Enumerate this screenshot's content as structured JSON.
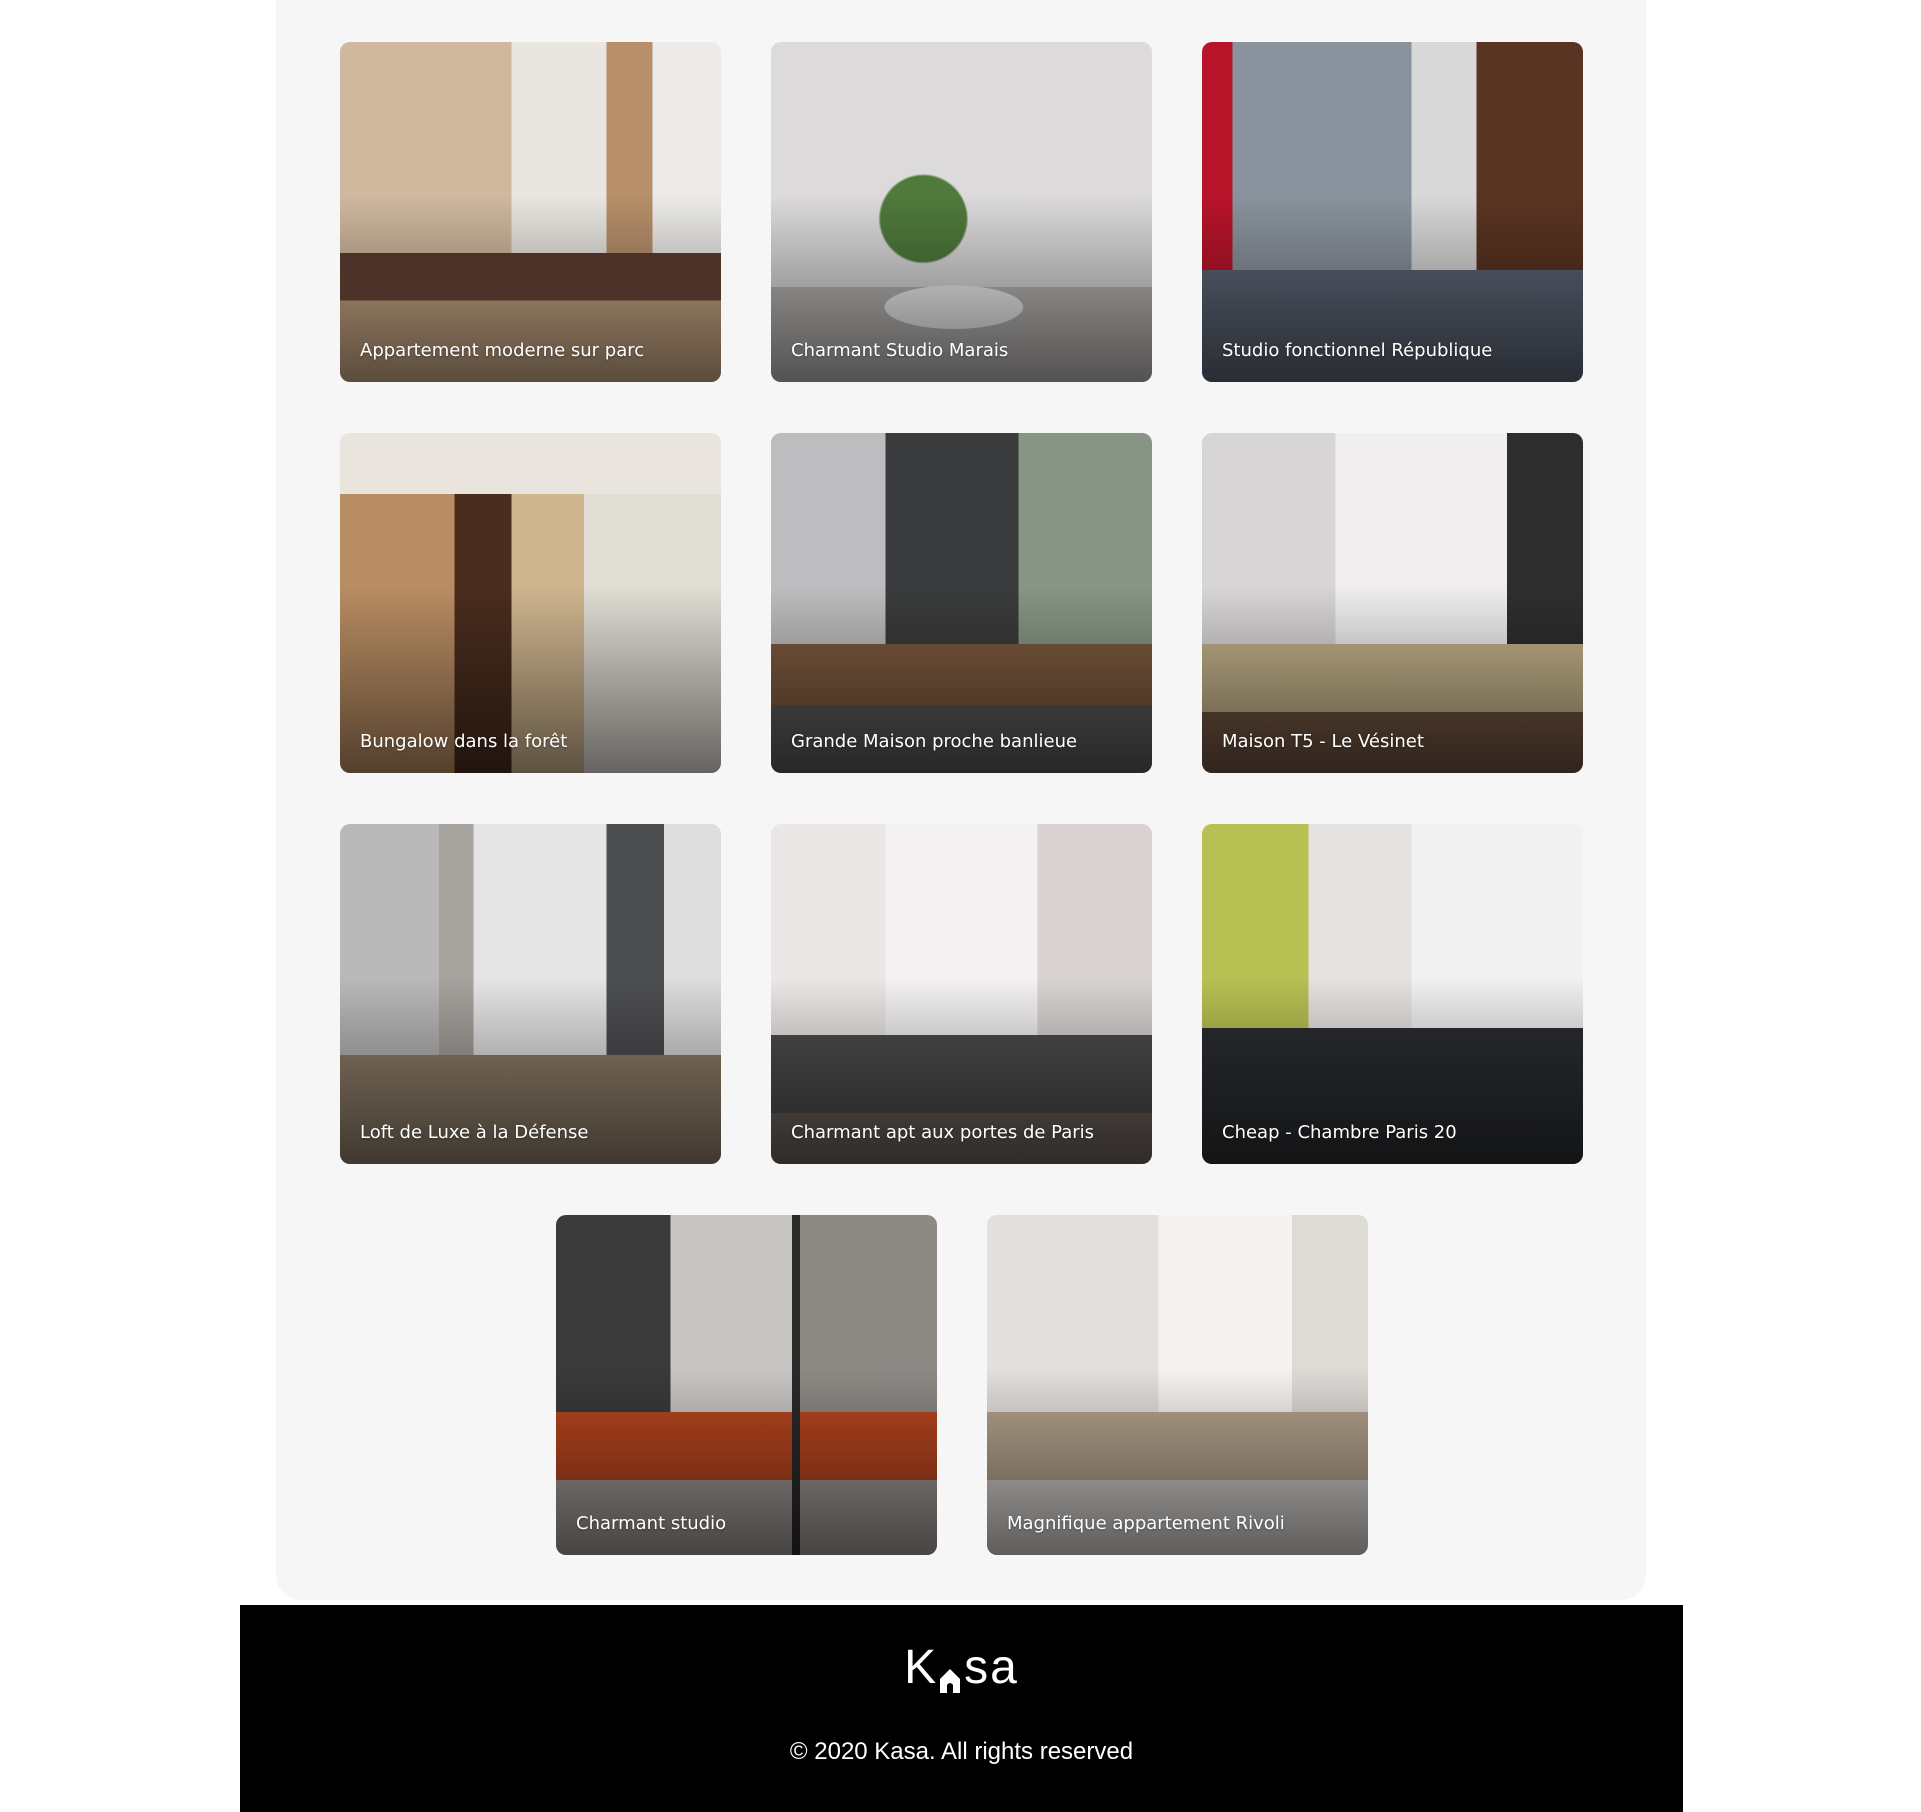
{
  "gallery": {
    "cards": [
      {
        "title": "Appartement moderne sur parc"
      },
      {
        "title": "Charmant Studio Marais"
      },
      {
        "title": "Studio fonctionnel République"
      },
      {
        "title": "Bungalow dans la forêt"
      },
      {
        "title": "Grande Maison proche banlieue"
      },
      {
        "title": "Maison T5 - Le Vésinet"
      },
      {
        "title": "Loft de Luxe à la Défense"
      },
      {
        "title": "Charmant apt aux portes de Paris"
      },
      {
        "title": "Cheap - Chambre Paris 20"
      },
      {
        "title": "Charmant studio"
      },
      {
        "title": "Magnifique appartement Rivoli"
      }
    ]
  },
  "footer": {
    "logo_left": "K",
    "logo_right": "sa",
    "logo_icon": "house-icon",
    "copyright": "© 2020 Kasa. All rights reserved"
  },
  "colors": {
    "footer_bg": "#000000",
    "gallery_bg": "#f6f6f6",
    "text_light": "#ffffff"
  }
}
